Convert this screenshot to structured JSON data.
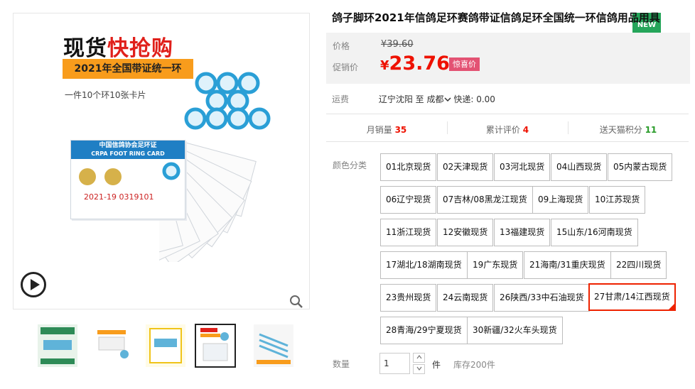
{
  "product": {
    "title": "鸽子脚环2021年信鸽足环赛鸽带证信鸽足环全国统一环信鸽用品用具"
  },
  "gallery": {
    "badge": "NEW",
    "headline_plain": "现货",
    "headline_red": "快抢购",
    "banner": "2021年全国带证统一环",
    "subline": "一件10个环10张卡片",
    "card_title": "中国信鸽协会足环证",
    "card_subtitle": "CRPA FOOT RING CARD",
    "card_number": "2021-19   0319101",
    "thumbnails_count": 5,
    "active_thumbnail": 4
  },
  "price": {
    "label_price": "价格",
    "old_price": "¥39.60",
    "label_promo": "促销价",
    "currency": "¥",
    "current_price": "23.76",
    "promo_tag": "惊喜价"
  },
  "shipping": {
    "label": "运费",
    "from": "辽宁沈阳",
    "to_word": "至",
    "to": "成都",
    "fee": "快递: 0.00"
  },
  "stats": {
    "sales_label": "月销量",
    "sales_value": "35",
    "reviews_label": "累计评价",
    "reviews_value": "4",
    "points_label": "送天猫积分",
    "points_value": "11"
  },
  "colors": {
    "label": "颜色分类",
    "options": [
      "01北京现货",
      "02天津现货",
      "03河北现货",
      "04山西现货",
      "05内蒙古现货",
      "06辽宁现货",
      "07吉林/08黑龙江现货",
      "09上海现货",
      "10江苏现货",
      "11浙江现货",
      "12安徽现货",
      "13福建现货",
      "15山东/16河南现货",
      "17湖北/18湖南现货",
      "19广东现货",
      "21海南/31重庆现货",
      "22四川现货",
      "23贵州现货",
      "24云南现货",
      "26陕西/33中石油现货",
      "27甘肃/14江西现货",
      "28青海/29宁夏现货",
      "30新疆/32火车头现货"
    ],
    "selected": "27甘肃/14江西现货"
  },
  "quantity": {
    "label": "数量",
    "value": "1",
    "unit": "件",
    "stock": "库存200件"
  },
  "colors_theme": {
    "price_red": "#ee1100",
    "badge_green": "#25a55a",
    "promo_pink": "#e35273",
    "points_green": "#2a9c2a"
  }
}
